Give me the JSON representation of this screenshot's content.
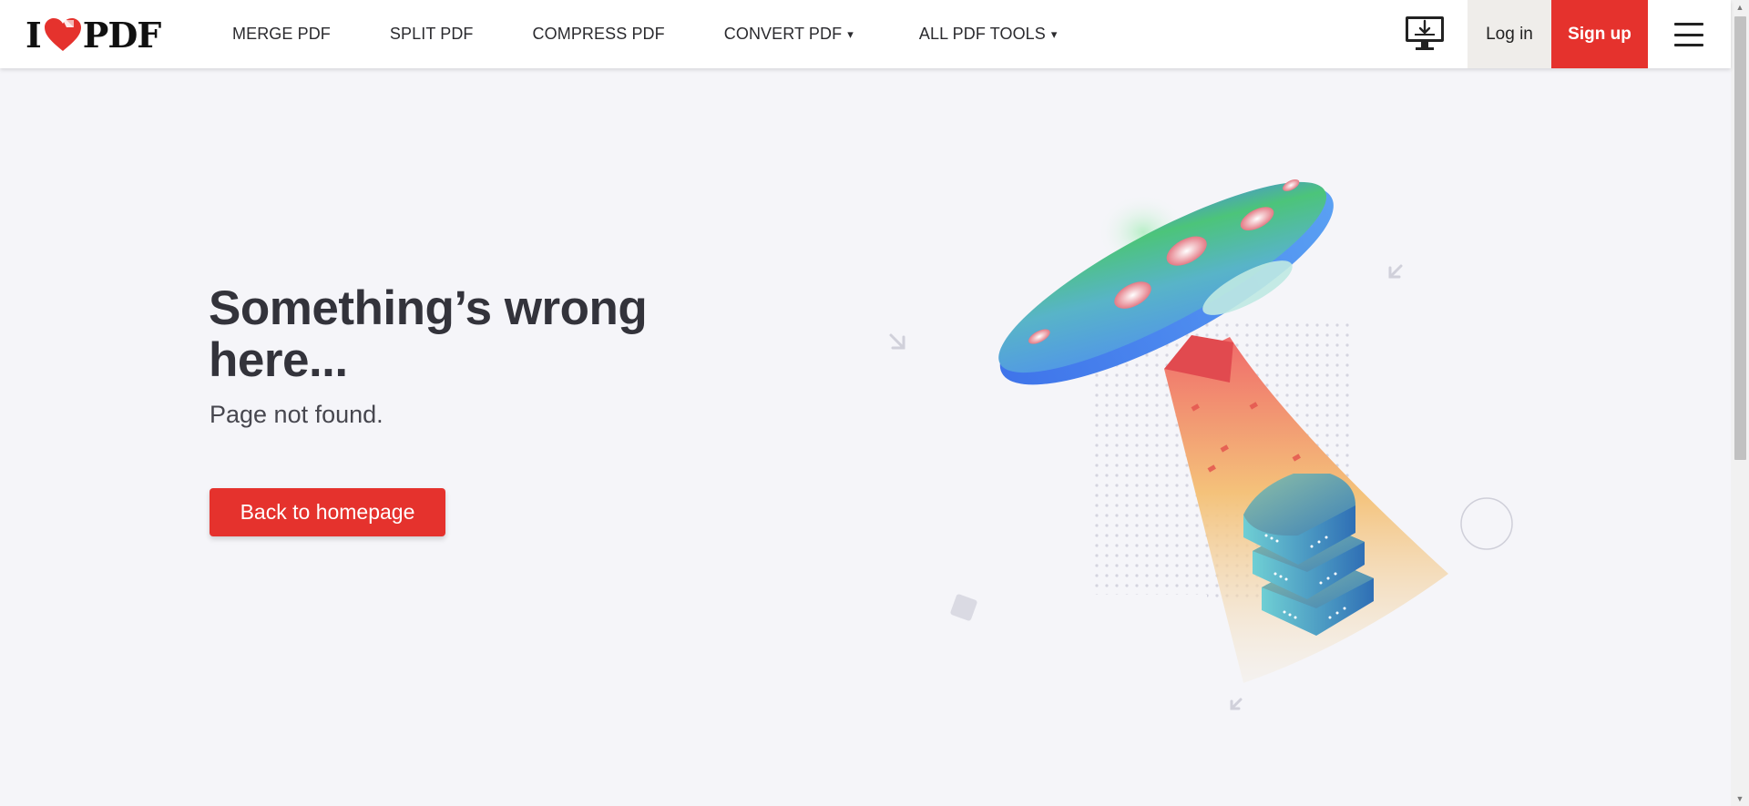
{
  "header": {
    "logo_text_left": "I",
    "logo_text_right": "PDF",
    "nav": [
      {
        "label": "MERGE PDF",
        "has_dropdown": false
      },
      {
        "label": "SPLIT PDF",
        "has_dropdown": false
      },
      {
        "label": "COMPRESS PDF",
        "has_dropdown": false
      },
      {
        "label": "CONVERT PDF",
        "has_dropdown": true
      },
      {
        "label": "ALL PDF TOOLS",
        "has_dropdown": true
      }
    ],
    "caret": "▾",
    "desktop_icon": "desktop-download-icon",
    "login_label": "Log in",
    "signup_label": "Sign up",
    "menu_icon": "hamburger-menu-icon"
  },
  "main": {
    "title": "Something’s wrong here...",
    "subtitle": "Page not found.",
    "button_label": "Back to homepage"
  },
  "colors": {
    "brand_red": "#e5322d",
    "background": "#f5f5f9",
    "text_dark": "#33333b",
    "login_bg": "#efedea"
  }
}
